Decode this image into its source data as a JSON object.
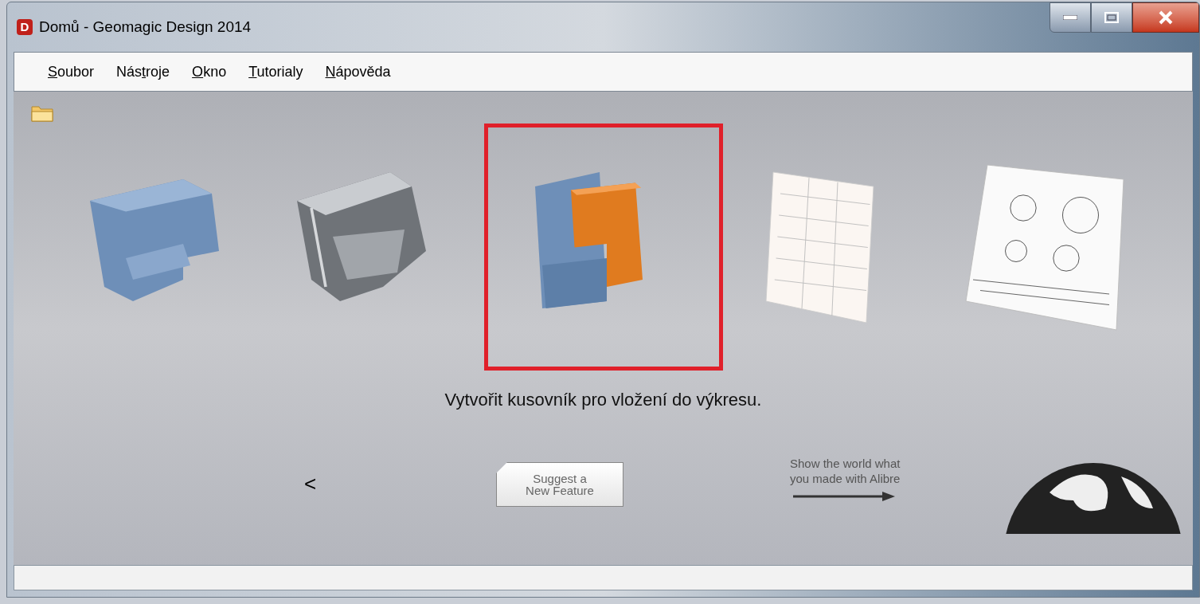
{
  "window": {
    "title": "Domů - Geomagic Design 2014",
    "app_letter": "D"
  },
  "menu": [
    {
      "key": "S",
      "end": "oubor"
    },
    {
      "start": "Nás",
      "key": "t",
      "end": "roje"
    },
    {
      "key": "O",
      "end": "kno"
    },
    {
      "key": "T",
      "end": "utorialy"
    },
    {
      "key": "N",
      "end": "ápověda"
    }
  ],
  "carousel": {
    "items": [
      {
        "kind": "part",
        "selected": false
      },
      {
        "kind": "sheet-metal",
        "selected": false
      },
      {
        "kind": "assembly",
        "selected": true
      },
      {
        "kind": "bom",
        "selected": false
      },
      {
        "kind": "drawing",
        "selected": false
      }
    ],
    "caption": "Vytvořit kusovník pro vložení do výkresu.",
    "back": "<"
  },
  "suggest_button": [
    "Suggest a",
    "New Feature"
  ],
  "promo": [
    "Show the world what",
    "you made with Alibre"
  ]
}
